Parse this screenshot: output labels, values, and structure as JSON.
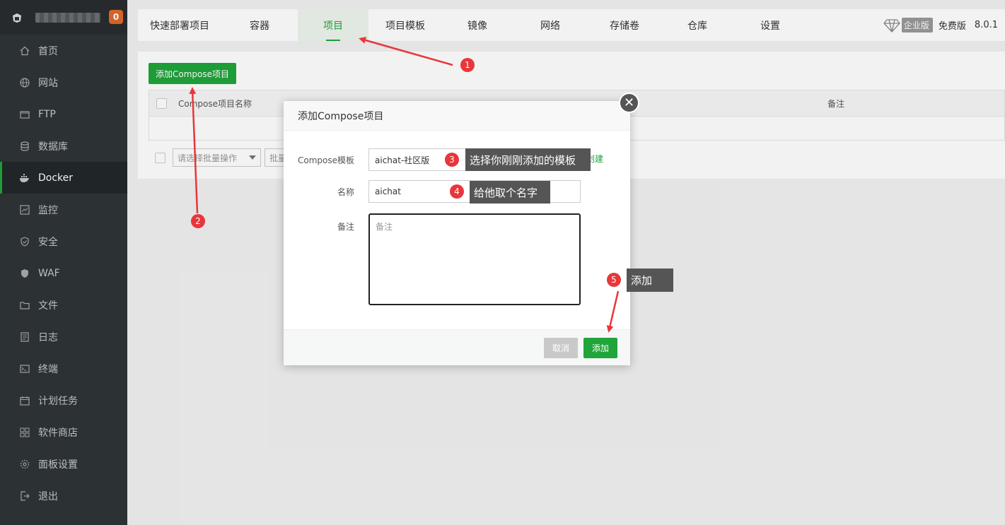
{
  "sidebar": {
    "badge": "0",
    "items": [
      {
        "label": "首页",
        "icon": "home-icon"
      },
      {
        "label": "网站",
        "icon": "globe-icon"
      },
      {
        "label": "FTP",
        "icon": "ftp-icon"
      },
      {
        "label": "数据库",
        "icon": "database-icon"
      },
      {
        "label": "Docker",
        "icon": "docker-icon",
        "active": true
      },
      {
        "label": "监控",
        "icon": "monitor-icon"
      },
      {
        "label": "安全",
        "icon": "shield-icon"
      },
      {
        "label": "WAF",
        "icon": "waf-icon"
      },
      {
        "label": "文件",
        "icon": "folder-icon"
      },
      {
        "label": "日志",
        "icon": "log-icon"
      },
      {
        "label": "终端",
        "icon": "terminal-icon"
      },
      {
        "label": "计划任务",
        "icon": "calendar-icon"
      },
      {
        "label": "软件商店",
        "icon": "apps-icon"
      },
      {
        "label": "面板设置",
        "icon": "gear-icon"
      },
      {
        "label": "退出",
        "icon": "logout-icon"
      }
    ]
  },
  "topnav": {
    "tabs": [
      "快速部署项目",
      "容器",
      "项目",
      "项目模板",
      "镜像",
      "网络",
      "存储卷",
      "仓库",
      "设置"
    ],
    "active_tab": "项目",
    "edition": "企业版",
    "free_label": "免费版",
    "version": "8.0.1"
  },
  "main": {
    "add_button": "添加Compose项目",
    "table_headers": [
      "Compose项目名称",
      "备注"
    ],
    "empty_text": "空",
    "batch_placeholder": "请选择批量操作",
    "batch_button": "批量"
  },
  "modal": {
    "title": "添加Compose项目",
    "template_label": "Compose模板",
    "template_value": "aichat-社区版",
    "create_link": "创建",
    "name_label": "名称",
    "name_value": "aichat",
    "remark_label": "备注",
    "remark_placeholder": "备注",
    "cancel": "取消",
    "add": "添加"
  },
  "annotations": {
    "n1": "1",
    "n2": "2",
    "n3": "3",
    "n4": "4",
    "n5": "5",
    "tip3": "选择你刚刚添加的模板",
    "tip4": "给他取个名字",
    "tip5": "添加"
  },
  "colors": {
    "accent": "#20a53a",
    "sidebar_bg": "#2f3437",
    "annotation_red": "#e8363b",
    "badge": "#e0692a"
  }
}
